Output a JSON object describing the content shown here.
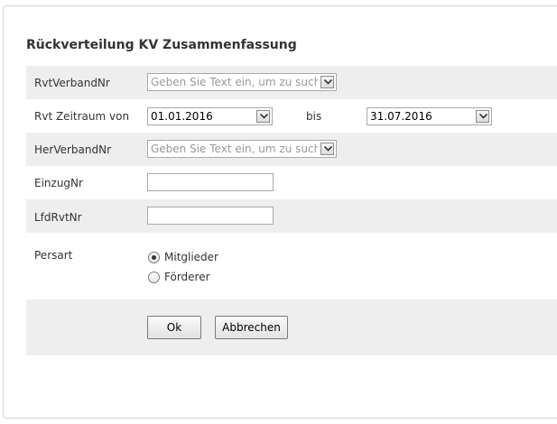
{
  "form": {
    "title": "Rückverteilung KV Zusammenfassung",
    "rvt_verband": {
      "label": "RvtVerbandNr",
      "placeholder": "Geben Sie Text ein, um zu suchen"
    },
    "rvt_zeitraum": {
      "label": "Rvt Zeitraum von",
      "from_value": "01.01.2016",
      "between_label": "bis",
      "to_value": "31.07.2016"
    },
    "her_verband": {
      "label": "HerVerbandNr",
      "placeholder": "Geben Sie Text ein, um zu suchen"
    },
    "einzug": {
      "label": "EinzugNr",
      "value": ""
    },
    "lfd_rvt": {
      "label": "LfdRvtNr",
      "value": ""
    },
    "persart": {
      "label": "Persart",
      "options": [
        {
          "label": "Mitglieder",
          "selected": true
        },
        {
          "label": "Förderer",
          "selected": false
        }
      ]
    },
    "buttons": {
      "ok": "Ok",
      "cancel": "Abbrechen"
    }
  }
}
